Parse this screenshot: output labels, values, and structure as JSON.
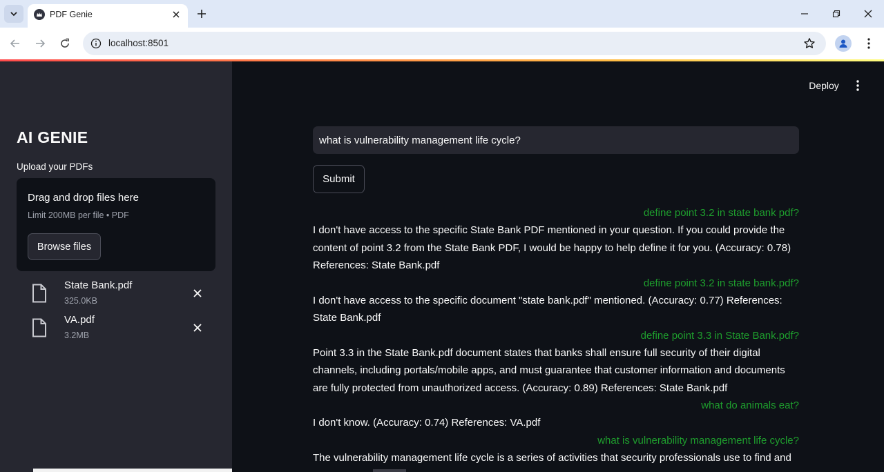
{
  "browser": {
    "tab_title": "PDF Genie",
    "url": "localhost:8501"
  },
  "header": {
    "deploy_label": "Deploy"
  },
  "sidebar": {
    "title": "AI GENIE",
    "upload_label": "Upload your PDFs",
    "dropzone": {
      "title": "Drag and drop files here",
      "limit": "Limit 200MB per file • PDF",
      "browse_label": "Browse files"
    },
    "files": [
      {
        "name": "State Bank.pdf",
        "size": "325.0KB"
      },
      {
        "name": "VA.pdf",
        "size": "3.2MB"
      }
    ]
  },
  "main": {
    "query_value": "what is vulnerability management life cycle?",
    "submit_label": "Submit",
    "chat": [
      {
        "question": "define point 3.2 in state bank pdf?",
        "answer": "I don't have access to the specific State Bank PDF mentioned in your question. If you could provide the content of point 3.2 from the State Bank PDF, I would be happy to help define it for you. (Accuracy: 0.78) References: State Bank.pdf"
      },
      {
        "question": "define point 3.2 in state bank.pdf?",
        "answer": "I don't have access to the specific document \"state bank.pdf\" mentioned. (Accuracy: 0.77) References: State Bank.pdf"
      },
      {
        "question": "define point 3.3 in State Bank.pdf?",
        "answer": "Point 3.3 in the State Bank.pdf document states that banks shall ensure full security of their digital channels, including portals/mobile apps, and must guarantee that customer information and documents are fully protected from unauthorized access. (Accuracy: 0.89) References: State Bank.pdf"
      },
      {
        "question": "what do animals eat?",
        "answer": "I don't know. (Accuracy: 0.74) References: VA.pdf"
      },
      {
        "question": "what is vulnerability management life cycle?",
        "answer": "The vulnerability management life cycle is a series of activities that security professionals use to find and"
      }
    ]
  },
  "colors": {
    "main_bg": "#0e1117",
    "sidebar_bg": "#262730",
    "question_text": "#1e9e2d",
    "text": "#fafafa"
  }
}
